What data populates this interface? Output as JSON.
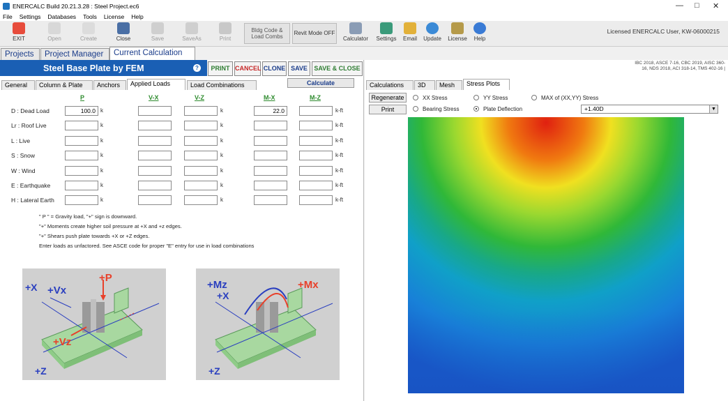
{
  "window": {
    "title": "ENERCALC Build 20.21.3.28 :  Steel Project.ec6"
  },
  "menu": [
    "File",
    "Settings",
    "Databases",
    "Tools",
    "License",
    "Help"
  ],
  "toolbar": {
    "exit": "EXIT",
    "open": "Open",
    "create": "Create",
    "close": "Close",
    "save": "Save",
    "saveas": "SaveAs",
    "print": "Print",
    "bldg_codes_1": "Bldg Code &",
    "bldg_codes_2": "Load Combs",
    "revit": "Revit Mode OFF",
    "calculator": "Calculator",
    "settings": "Settings",
    "email": "Email",
    "update": "Update",
    "license": "License",
    "help": "Help"
  },
  "license_text": "Licensed ENERCALC User, KW-06000215",
  "main_tabs": [
    "Projects",
    "Project Manager",
    "Current Calculation"
  ],
  "calc": {
    "title": "Steel Base Plate by FEM",
    "help": "?",
    "buttons": {
      "print": "PRINT",
      "cancel": "CANCEL",
      "clone": "CLONE",
      "save": "SAVE",
      "save_close": "SAVE & CLOSE"
    },
    "subtabs": [
      "General",
      "Column & Plate",
      "Anchors",
      "Applied Loads",
      "Load Combinations"
    ],
    "calculate": "Calculate",
    "columns": [
      "P",
      "V-X",
      "V-Z",
      "M-X",
      "M-Z"
    ],
    "units": {
      "k": "k",
      "kft": "k-ft"
    },
    "rows": [
      {
        "label": "D : Dead Load",
        "P": "100.0",
        "VX": "",
        "VZ": "",
        "MX": "22.0",
        "MZ": ""
      },
      {
        "label": "Lr : Roof Live",
        "P": "",
        "VX": "",
        "VZ": "",
        "MX": "",
        "MZ": ""
      },
      {
        "label": "L : Live",
        "P": "",
        "VX": "",
        "VZ": "",
        "MX": "",
        "MZ": ""
      },
      {
        "label": "S : Snow",
        "P": "",
        "VX": "",
        "VZ": "",
        "MX": "",
        "MZ": ""
      },
      {
        "label": "W : Wind",
        "P": "",
        "VX": "",
        "VZ": "",
        "MX": "",
        "MZ": ""
      },
      {
        "label": "E : Earthquake",
        "P": "",
        "VX": "",
        "VZ": "",
        "MX": "",
        "MZ": ""
      },
      {
        "label": "H : Lateral Earth",
        "P": "",
        "VX": "",
        "VZ": "",
        "MX": "",
        "MZ": ""
      }
    ],
    "notes": [
      "\" P \" = Gravity load, \"+\" sign is downward.",
      "\"+\"  Moments create higher soil pressure at +X and +z edges.",
      "\"+\"  Shears push plate towards +X or +Z edges.",
      "Enter loads as unfactored. See ASCE code for proper \"E\" entry for use in load combinations"
    ],
    "diagram1": {
      "p": "+P",
      "x": "+X",
      "vx": "+Vx",
      "vz": "+Vz",
      "z": "+Z"
    },
    "diagram2": {
      "mz": "+Mz",
      "mx": "+Mx",
      "x": "+X",
      "z": "+Z"
    }
  },
  "results": {
    "codes_1": "IBC 2018, ASCE 7-16, CBC 2019, AISC 360-",
    "codes_2": "16, NDS 2018, ACI 318-14, TMS 402-16 |",
    "tabs": [
      "Calculations",
      "3D",
      "Mesh",
      "Stress Plots"
    ],
    "regenerate": "Regenerate",
    "print": "Print",
    "radios": {
      "xx": "XX Stress",
      "yy": "YY Stress",
      "max": "MAX of (XX,YY) Stress",
      "bearing": "Bearing Stress",
      "deflection": "Plate Deflection"
    },
    "selected": "deflection",
    "combo": "+1.40D"
  },
  "colors": {
    "accent": "#1a5fb4",
    "tab_text": "#1a3c8a",
    "column_header": "#2e8b2e",
    "diagram_red": "#e8402a",
    "diagram_blue": "#2a3fbf"
  }
}
